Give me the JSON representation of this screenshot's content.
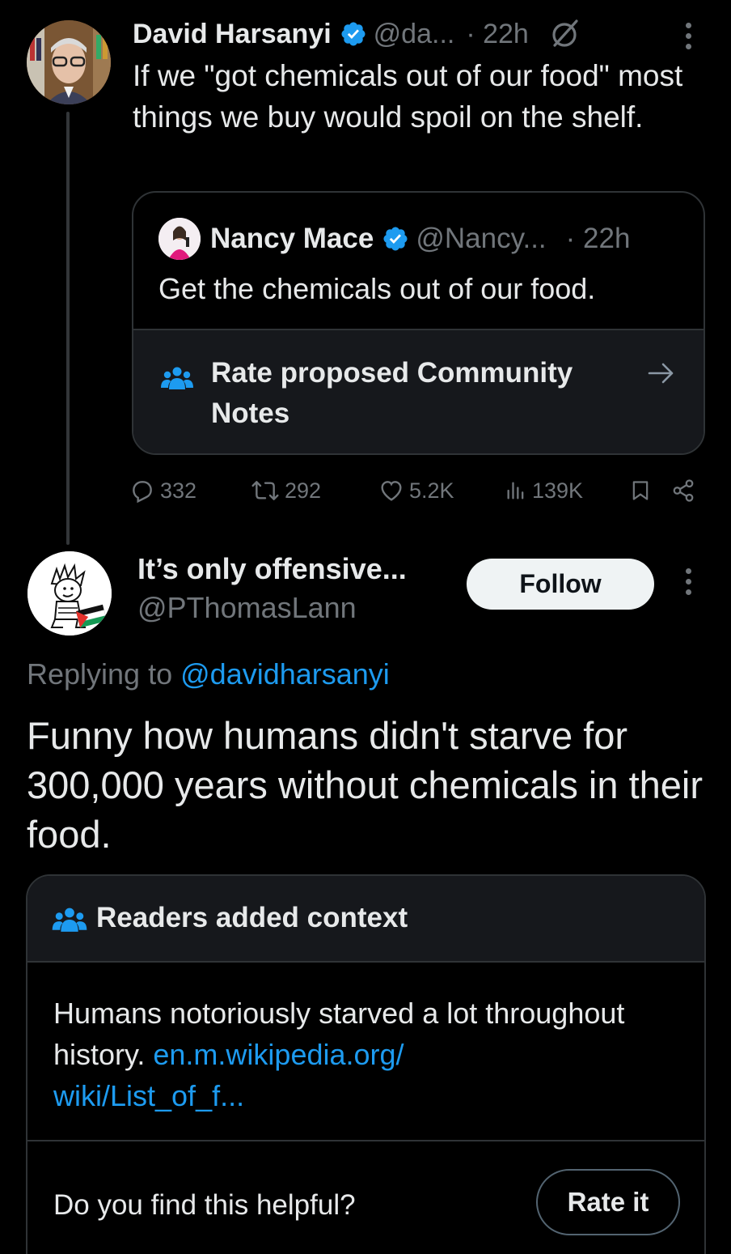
{
  "parent": {
    "name": "David Harsanyi",
    "handle": "@da...",
    "time": "· 22h",
    "text": "If we \"got chemicals out of our food\" most things we buy would spoil on the shelf.",
    "quote": {
      "name": "Nancy Mace",
      "handle": "@Nancy...",
      "time": "· 22h",
      "text": "Get the chemicals out of our food.",
      "notes_label": "Rate proposed Community Notes"
    },
    "stats": {
      "replies": "332",
      "reposts": "292",
      "likes": "5.2K",
      "views": "139K"
    }
  },
  "reply": {
    "name": "It’s only offensive...",
    "handle": "@PThomasLann",
    "follow_label": "Follow",
    "replying_prefix": "Replying to",
    "replying_to": "@davidharsanyi",
    "text": "Funny how humans didn't starve for 300,000 years without chemicals in their food."
  },
  "note": {
    "title": "Readers added context",
    "body": "Humans notoriously starved a lot throughout history.",
    "link_line1": "en.m.wikipedia.org/",
    "link_line2": "wiki/List_of_f...",
    "question": "Do you find this helpful?",
    "rate_label": "Rate it"
  },
  "colors": {
    "accent": "#1d9bf0",
    "muted": "#71767b",
    "border": "#2f3336",
    "card": "#16181c"
  },
  "icons": [
    "verified-badge-icon",
    "grok-icon",
    "more-icon",
    "community-notes-icon",
    "arrow-right-icon",
    "reply-icon",
    "repost-icon",
    "like-icon",
    "views-icon",
    "bookmark-icon",
    "share-icon"
  ]
}
